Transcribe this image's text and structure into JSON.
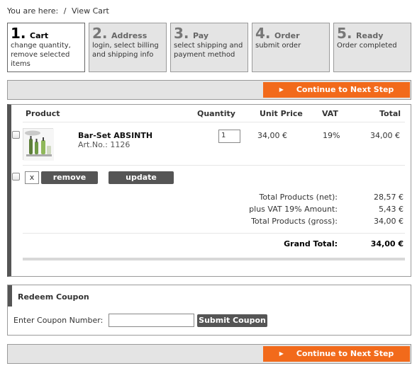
{
  "breadcrumb": {
    "prefix": "You are here:",
    "separator": "/",
    "current": "View Cart"
  },
  "steps": [
    {
      "number": "1.",
      "title": "Cart",
      "desc": "change quantity, remove selected items",
      "active": true
    },
    {
      "number": "2.",
      "title": "Address",
      "desc": "login, select billing and shipping info",
      "active": false
    },
    {
      "number": "3.",
      "title": "Pay",
      "desc": "select shipping and payment method",
      "active": false
    },
    {
      "number": "4.",
      "title": "Order",
      "desc": "submit order",
      "active": false
    },
    {
      "number": "5.",
      "title": "Ready",
      "desc": "Order completed",
      "active": false
    }
  ],
  "next_button": {
    "arrow": "▶",
    "label": "Continue to Next Step"
  },
  "table": {
    "headers": {
      "product": "Product",
      "quantity": "Quantity",
      "unit_price": "Unit Price",
      "vat": "VAT",
      "total": "Total"
    },
    "items": [
      {
        "name": "Bar-Set ABSINTH",
        "art_no": "Art.No.: 1126",
        "quantity": "1",
        "unit_price": "34,00 €",
        "vat": "19%",
        "total": "34,00 €"
      }
    ],
    "x_mark": "x",
    "remove_label": "remove",
    "update_label": "update"
  },
  "summary": {
    "net_label": "Total Products (net):",
    "net_value": "28,57 €",
    "vat_label": "plus VAT 19% Amount:",
    "vat_value": "5,43 €",
    "gross_label": "Total Products (gross):",
    "gross_value": "34,00 €",
    "grand_label": "Grand Total:",
    "grand_value": "34,00 €"
  },
  "coupon": {
    "title": "Redeem Coupon",
    "label": "Enter Coupon Number:",
    "value": "",
    "submit_label": "Submit Coupon"
  },
  "colors": {
    "accent": "#f26a1b",
    "dark_button": "#555555",
    "panel": "#e4e4e4"
  }
}
